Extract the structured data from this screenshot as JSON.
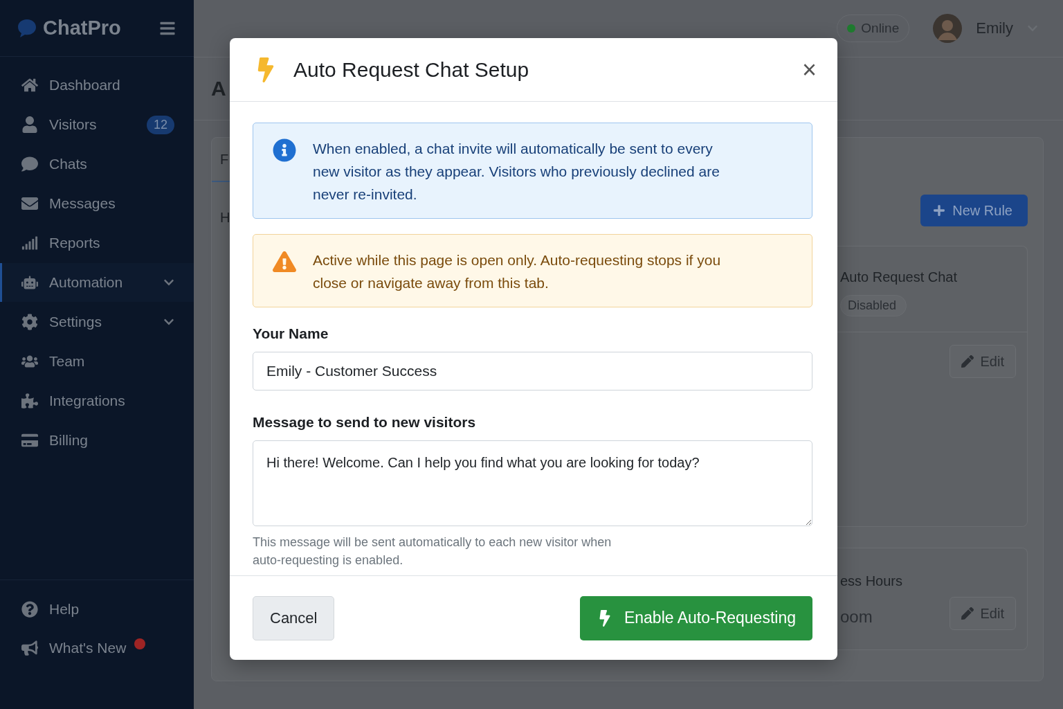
{
  "sidebar": {
    "brand": "ChatPro",
    "nav": [
      {
        "label": "Dashboard",
        "selected": false,
        "expandable": false
      },
      {
        "label": "Visitors",
        "selected": false,
        "expandable": false,
        "badge": "12"
      },
      {
        "label": "Chats",
        "selected": false,
        "expandable": false
      },
      {
        "label": "Messages",
        "selected": false,
        "expandable": false
      },
      {
        "label": "Reports",
        "selected": false,
        "expandable": false
      },
      {
        "label": "Automation",
        "selected": true,
        "expandable": true
      },
      {
        "label": "Settings",
        "selected": false,
        "expandable": true
      },
      {
        "label": "Team",
        "selected": false,
        "expandable": false
      },
      {
        "label": "Integrations",
        "selected": false,
        "expandable": false
      },
      {
        "label": "Billing",
        "selected": false,
        "expandable": false
      }
    ],
    "footer": [
      {
        "label": "Help",
        "dot": false
      },
      {
        "label": "What's New",
        "dot": true
      }
    ]
  },
  "topbar": {
    "status": "Online",
    "user": "Emily"
  },
  "page": {
    "title": "A",
    "tab": "F",
    "section_heading": "H",
    "new_rule": "New Rule",
    "rules": [
      {
        "title": "Auto Request Chat",
        "status": "Disabled",
        "edit": "Edit"
      },
      {
        "title": "ess Hours",
        "subtitle": "oom",
        "edit": "Edit"
      }
    ]
  },
  "dialog": {
    "title": "Auto Request Chat Setup",
    "close": "×",
    "info": "When enabled, a chat invite will automatically be sent to every new visitor as they appear. Visitors who previously declined are never re-invited.",
    "warning": "Active while this page is open only. Auto-requesting stops if you close or navigate away from this tab.",
    "name_label": "Your Name",
    "name_value": "Emily - Customer Success",
    "message_label": "Message to send to new visitors",
    "message_value": "Hi there! Welcome. Can I help you find what you are looking for today?",
    "hint": "This message will be sent automatically to each new visitor when auto-requesting is enabled.",
    "cancel": "Cancel",
    "confirm": "Enable Auto-Requesting"
  }
}
